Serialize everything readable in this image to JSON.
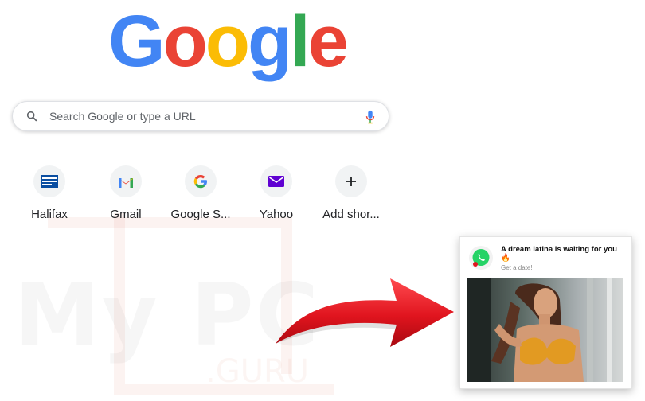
{
  "logo": {
    "letters": [
      "G",
      "o",
      "o",
      "g",
      "l",
      "e"
    ],
    "colors": [
      "#4285F4",
      "#EA4335",
      "#FBBC05",
      "#4285F4",
      "#34A853",
      "#EA4335"
    ]
  },
  "search": {
    "placeholder": "Search Google or type a URL",
    "icon": "search-icon",
    "mic_icon": "mic-icon"
  },
  "shortcuts": [
    {
      "label": "Halifax",
      "icon": "halifax-icon"
    },
    {
      "label": "Gmail",
      "icon": "gmail-icon"
    },
    {
      "label": "Google S...",
      "icon": "google-icon"
    },
    {
      "label": "Yahoo",
      "icon": "yahoo-mail-icon"
    },
    {
      "label": "Add shor...",
      "icon": "plus-icon"
    }
  ],
  "popup": {
    "title": "A dream latina is waiting for you 🔥",
    "subtitle": "Get a date!",
    "app_icon": "whatsapp-icon"
  },
  "watermark": {
    "text": "My PC",
    "sub": ".GURU"
  },
  "colors": {
    "arrow_red": "#e0141e",
    "whatsapp_green": "#25D366"
  }
}
